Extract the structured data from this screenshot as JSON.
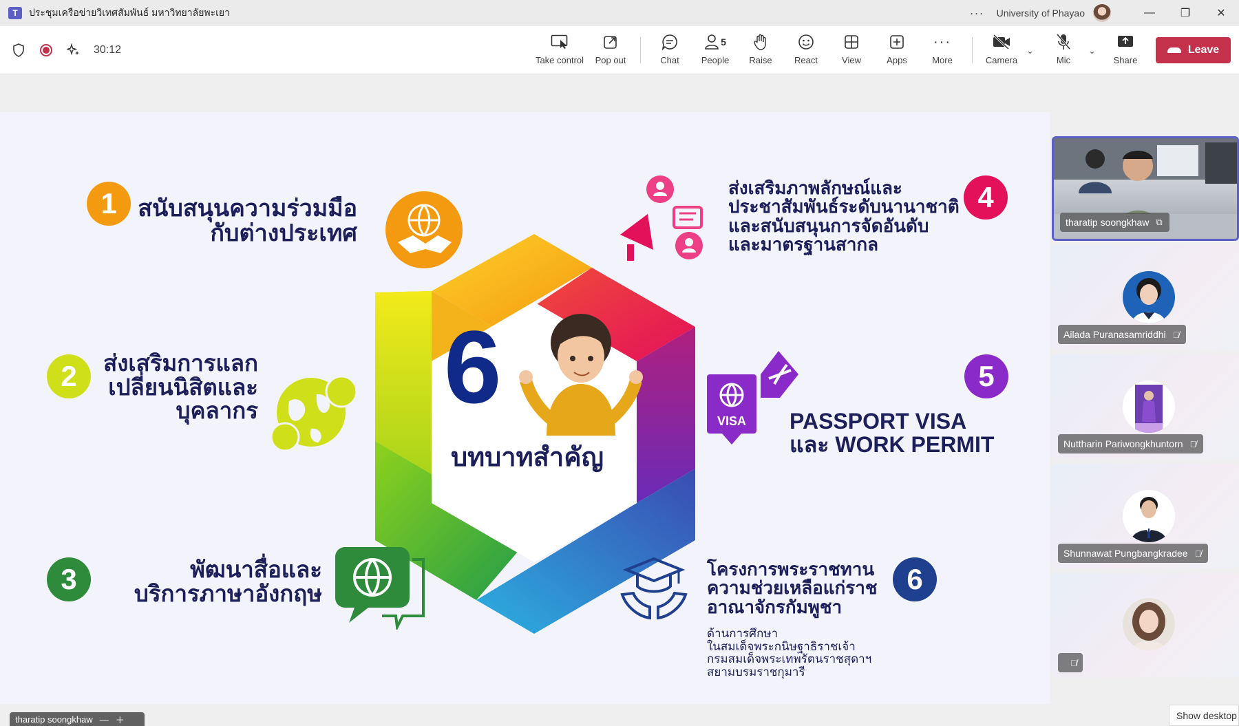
{
  "window": {
    "title": "ประชุมเครือข่ายวิเทศสัมพันธ์ มหาวิทยาลัยพะเยา",
    "organization": "University of Phayao",
    "more_icon": "ellipsis-icon"
  },
  "toolbar": {
    "timer": "30:12",
    "buttons": [
      {
        "label": "Take control",
        "icon": "take-control-icon"
      },
      {
        "label": "Pop out",
        "icon": "pop-out-icon"
      },
      {
        "label": "Chat",
        "icon": "chat-icon"
      },
      {
        "label": "People",
        "icon": "people-icon",
        "count": "5"
      },
      {
        "label": "Raise",
        "icon": "hand-icon"
      },
      {
        "label": "React",
        "icon": "smile-icon"
      },
      {
        "label": "View",
        "icon": "grid-icon"
      },
      {
        "label": "Apps",
        "icon": "plus-box-icon"
      },
      {
        "label": "More",
        "icon": "ellipsis-icon"
      },
      {
        "label": "Camera",
        "icon": "camera-off-icon"
      },
      {
        "label": "Mic",
        "icon": "mic-off-icon"
      },
      {
        "label": "Share",
        "icon": "share-icon"
      }
    ],
    "leave_label": "Leave"
  },
  "slide": {
    "center_number": "6",
    "center_title": "บทบาทสำคัญ",
    "items": [
      {
        "number": "1",
        "lines": [
          "สนับสนุนความร่วมมือ",
          "กับต่างประเทศ"
        ],
        "color": "#f39a10"
      },
      {
        "number": "2",
        "lines": [
          "ส่งเสริมการแลก",
          "เปลี่ยนนิสิตและ",
          "บุคลากร"
        ],
        "color": "#cfe01a"
      },
      {
        "number": "3",
        "lines": [
          "พัฒนาสื่อและ",
          "บริการภาษาอังกฤษ"
        ],
        "color": "#2e8b3c"
      },
      {
        "number": "4",
        "lines": [
          "ส่งเสริมภาพลักษณ์และ",
          "ประชาสัมพันธ์ระดับนานาชาติ",
          "และสนับสนุนการจัดอันดับ",
          "และมาตรฐานสากล"
        ],
        "color": "#e3105a"
      },
      {
        "number": "5",
        "lines": [
          "PASSPORT VISA",
          "และ WORK PERMIT"
        ],
        "color": "#8a2bc9"
      },
      {
        "number": "6",
        "lines": [
          "โครงการพระราชทาน",
          "ความช่วยเหลือแก่ราช",
          "อาณาจักรกัมพูชา"
        ],
        "color": "#1f3f8f"
      }
    ],
    "item6_sub": [
      "ด้านการศึกษา",
      "ในสมเด็จพระกนิษฐาธิราชเจ้า",
      "กรมสมเด็จพระเทพรัตนราชสุดาฯ",
      "สยามบรมราชกุมารี"
    ],
    "visa_label": "VISA"
  },
  "participants": [
    {
      "name": "tharatip soongkhaw",
      "active": true
    },
    {
      "name": "Ailada Puranasamriddhi",
      "active": false
    },
    {
      "name": "Nuttharin Pariwongkhuntorn",
      "active": false
    },
    {
      "name": "Shunnawat Pungbangkradee",
      "active": false
    },
    {
      "name": "",
      "active": false
    }
  ],
  "self_view_label": "tharatip soongkhaw",
  "show_desktop_label": "Show desktop"
}
